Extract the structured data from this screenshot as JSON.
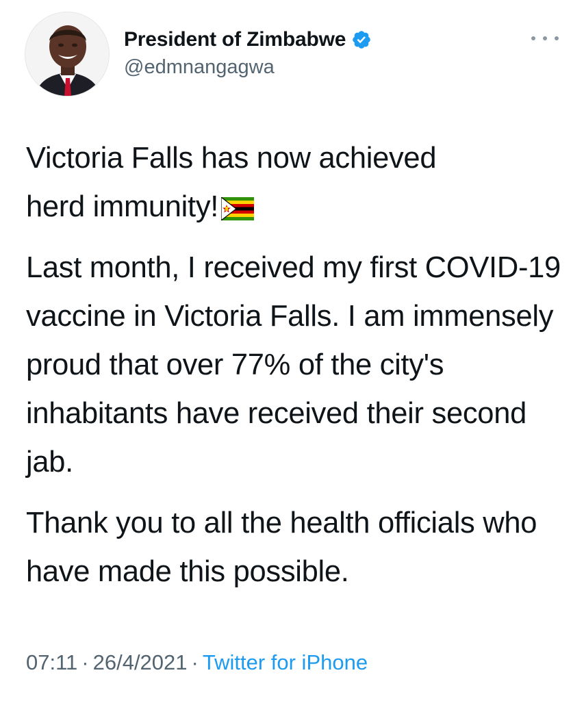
{
  "author": {
    "display_name": "President of Zimbabwe",
    "handle": "@edmnangagwa",
    "verified": true,
    "avatar_icon": "profile-photo"
  },
  "tweet": {
    "line1": "Victoria Falls has now achieved",
    "line2": "herd immunity!",
    "emoji": "zimbabwe-flag-icon",
    "paragraph2": "Last month, I received my first COVID-19 vaccine in Victoria Falls. I am immensely proud that over 77% of the city's inhabitants have received their second jab.",
    "paragraph3": "Thank you to all the health officials who have made this possible."
  },
  "meta": {
    "time": "07:11",
    "separator": "·",
    "date": "26/4/2021",
    "source": "Twitter for iPhone"
  },
  "colors": {
    "verified_blue": "#1d9bf0",
    "secondary_text": "#536471",
    "primary_text": "#0f1419",
    "link_blue": "#1d9bf0"
  }
}
